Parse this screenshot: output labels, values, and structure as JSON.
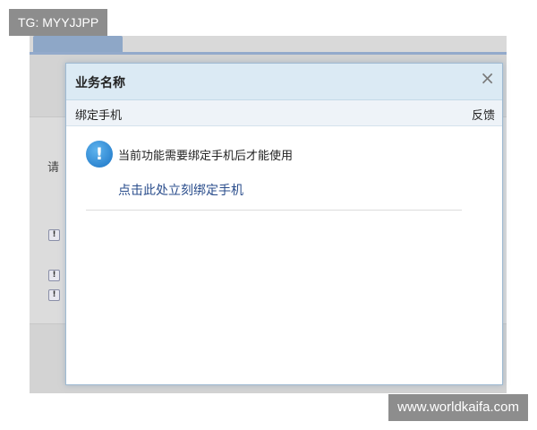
{
  "watermarks": {
    "top_left": "TG: MYYJJPP",
    "bottom_right": "www.worldkaifa.com"
  },
  "background": {
    "partial_label": "请",
    "warning_icon": "exclamation-icon"
  },
  "dialog": {
    "title": "业务名称",
    "close_icon": "close-icon",
    "tab_label": "绑定手机",
    "feedback_label": "反馈",
    "info_icon": "info-icon",
    "message": "当前功能需要绑定手机后才能使用",
    "link_text": "点击此处立刻绑定手机"
  },
  "colors": {
    "header_bg": "#dbeaf4",
    "link": "#2a4d8c",
    "info_blue": "#1a73c5",
    "tag_bg": "#8d8d8d"
  }
}
